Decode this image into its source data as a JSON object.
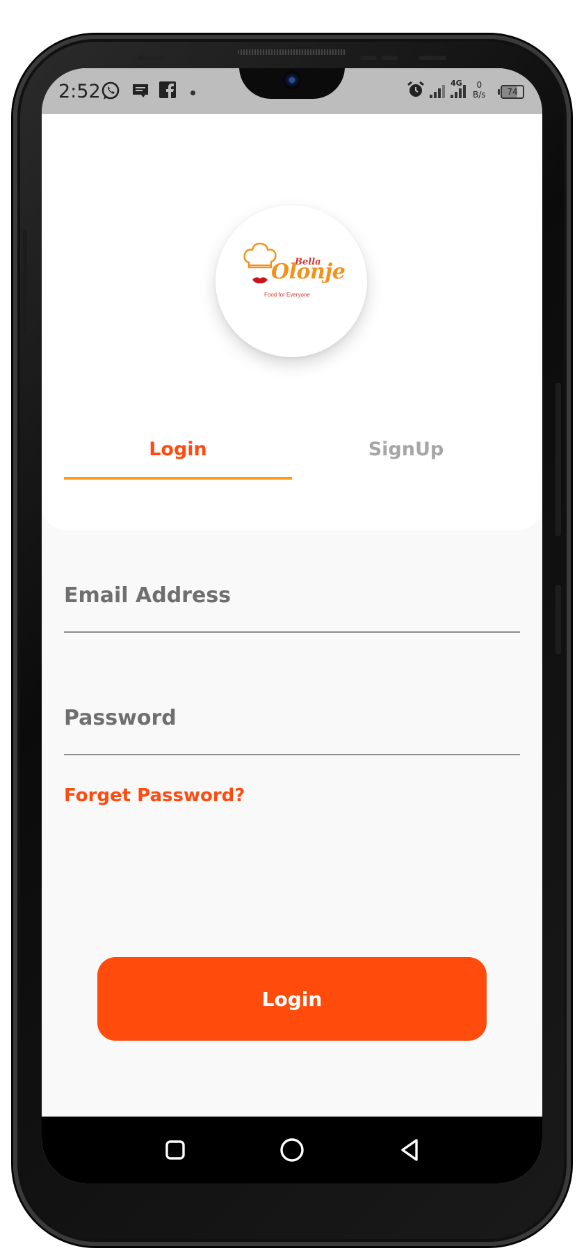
{
  "status_bar": {
    "time": "2:52",
    "icons": [
      "whatsapp-icon",
      "message-icon",
      "facebook-icon",
      "dot-icon",
      "alarm-icon",
      "signal-icon",
      "signal-4g-icon"
    ],
    "network_label": "4G",
    "speed_value": "0",
    "speed_unit": "B/s",
    "battery": "74"
  },
  "logo": {
    "brand_small": "Bella",
    "brand_large": "Olonje",
    "tagline": "Food for Everyone"
  },
  "tabs": [
    {
      "label": "Login",
      "active": true
    },
    {
      "label": "SignUp",
      "active": false
    }
  ],
  "form": {
    "email_placeholder": "Email Address",
    "password_placeholder": "Password",
    "forgot_label": "Forget Password?",
    "submit_label": "Login"
  },
  "colors": {
    "accent": "#ff4b0c",
    "tab_indicator": "#ff9a16",
    "inactive_tab": "#a6a6a6",
    "logo_orange": "#f2921d",
    "logo_red": "#d8352a"
  },
  "nav": [
    "recent-apps-icon",
    "home-icon",
    "back-icon"
  ]
}
